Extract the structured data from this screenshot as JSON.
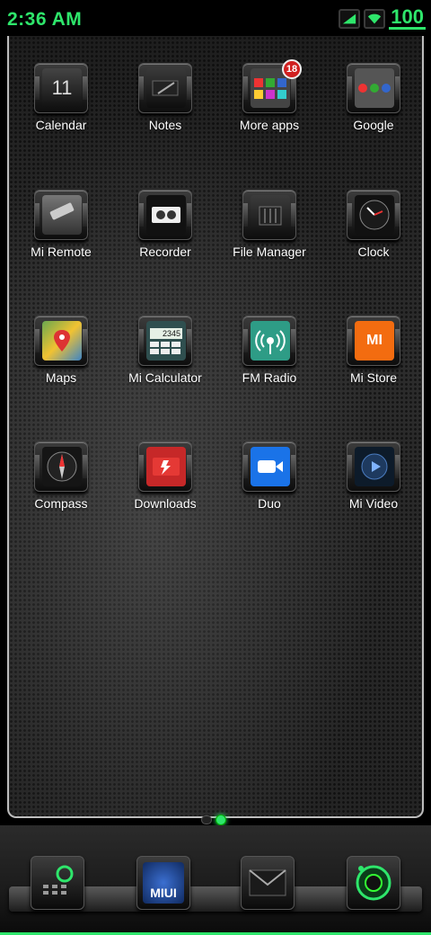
{
  "status_bar": {
    "time": "2:36 AM",
    "battery": "100"
  },
  "apps": [
    {
      "label": "Calendar",
      "icon": "calendar-icon",
      "glyph": "11"
    },
    {
      "label": "Notes",
      "icon": "notes-icon"
    },
    {
      "label": "More apps",
      "icon": "more-apps-icon",
      "badge": "18"
    },
    {
      "label": "Google",
      "icon": "google-icon"
    },
    {
      "label": "Mi Remote",
      "icon": "remote-icon"
    },
    {
      "label": "Recorder",
      "icon": "recorder-icon"
    },
    {
      "label": "File Manager",
      "icon": "file-manager-icon"
    },
    {
      "label": "Clock",
      "icon": "clock-icon"
    },
    {
      "label": "Maps",
      "icon": "maps-icon"
    },
    {
      "label": "Mi Calculator",
      "icon": "calculator-icon",
      "glyph": "2345"
    },
    {
      "label": "FM Radio",
      "icon": "radio-icon"
    },
    {
      "label": "Mi Store",
      "icon": "mi-store-icon",
      "glyph": "MI"
    },
    {
      "label": "Compass",
      "icon": "compass-icon"
    },
    {
      "label": "Downloads",
      "icon": "downloads-icon"
    },
    {
      "label": "Duo",
      "icon": "duo-icon"
    },
    {
      "label": "Mi Video",
      "icon": "video-icon"
    }
  ],
  "dock": [
    {
      "name": "phone-dialer-icon"
    },
    {
      "name": "miui-icon",
      "glyph": "MIUI"
    },
    {
      "name": "messages-icon"
    },
    {
      "name": "camera-icon"
    }
  ],
  "colors": {
    "accent": "#2ee66b",
    "badge": "#d02020"
  }
}
